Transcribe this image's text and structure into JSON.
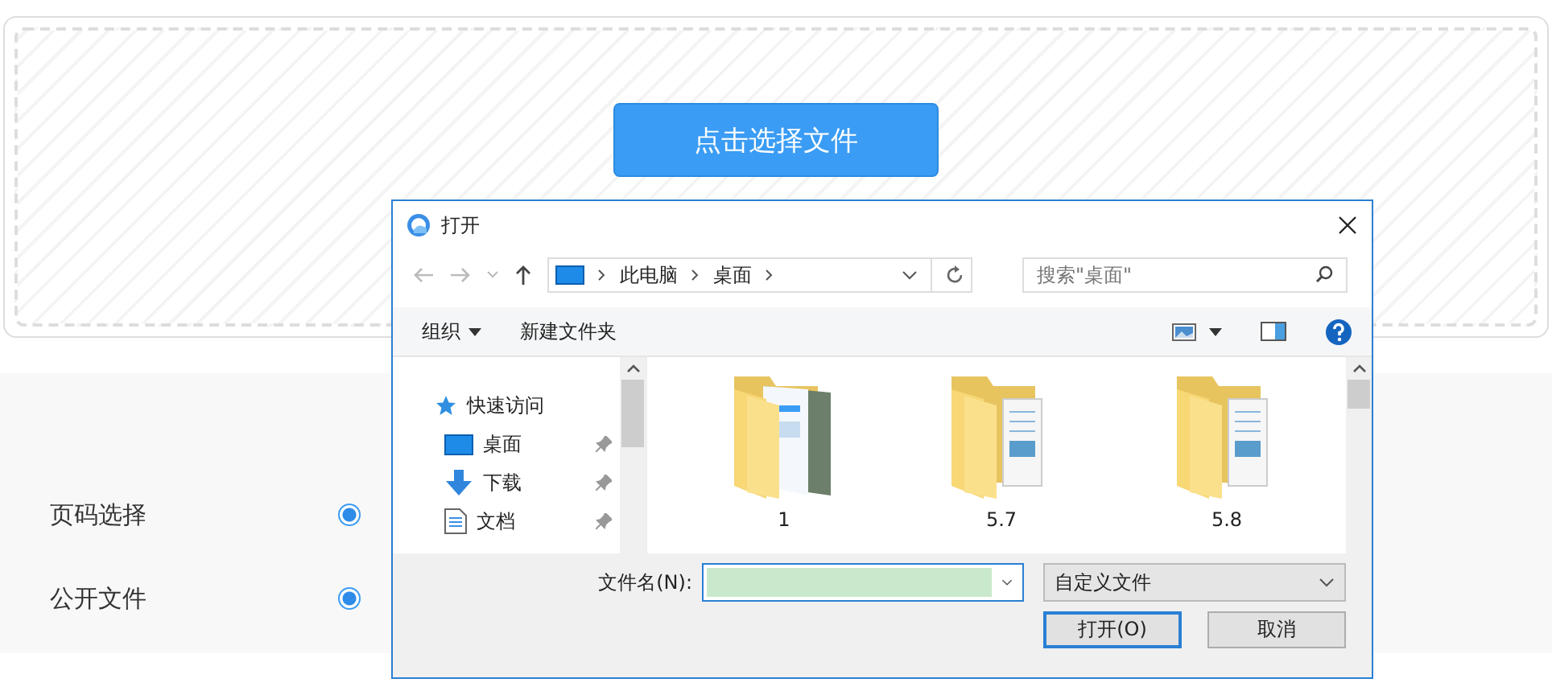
{
  "upload": {
    "button": "点击选择文件"
  },
  "form": {
    "rows": [
      {
        "label": "页码选择",
        "selected": true
      },
      {
        "label": "公开文件",
        "selected": true
      }
    ]
  },
  "dialog": {
    "title": "打开",
    "breadcrumb": [
      "此电脑",
      "桌面"
    ],
    "search": {
      "placeholder": "搜索\"桌面\""
    },
    "toolbar": {
      "organize": "组织",
      "new_folder": "新建文件夹"
    },
    "nav": [
      {
        "label": "快速访问",
        "kind": "star",
        "pinned": false
      },
      {
        "label": "桌面",
        "kind": "desktop",
        "pinned": true
      },
      {
        "label": "下载",
        "kind": "download",
        "pinned": true
      },
      {
        "label": "文档",
        "kind": "document",
        "pinned": true
      }
    ],
    "files": [
      {
        "name": "1",
        "kind": "picture-folder"
      },
      {
        "name": "5.7",
        "kind": "folder"
      },
      {
        "name": "5.8",
        "kind": "folder"
      }
    ],
    "filename": {
      "label": "文件名(N):"
    },
    "filter": "自定义文件",
    "buttons": [
      {
        "label": "打开(O)",
        "default": true
      },
      {
        "label": "取消",
        "default": false
      }
    ]
  }
}
